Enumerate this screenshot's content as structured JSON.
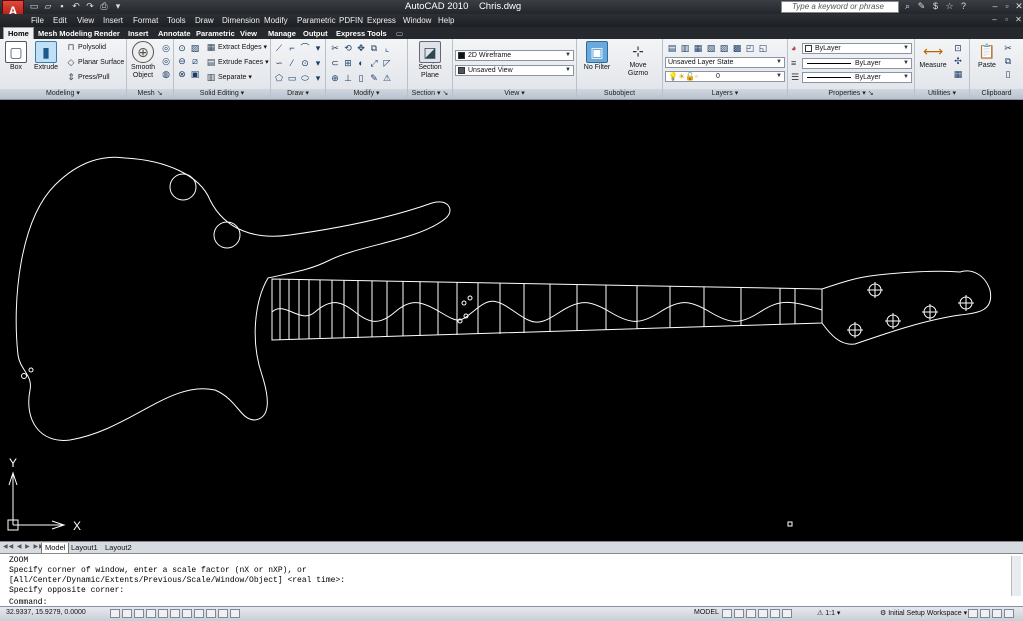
{
  "app": {
    "title": "AutoCAD 2010",
    "filename": "Chris.dwg",
    "logo_letter": "A",
    "help_placeholder": "Type a keyword or phrase"
  },
  "menus": [
    "File",
    "Edit",
    "View",
    "Insert",
    "Format",
    "Tools",
    "Draw",
    "Dimension",
    "Modify",
    "Parametric",
    "PDFIN",
    "Express",
    "Window",
    "Help"
  ],
  "ribbon_tabs": [
    "Home",
    "Mesh Modeling",
    "Render",
    "Insert",
    "Annotate",
    "Parametric",
    "View",
    "Manage",
    "Output",
    "Express Tools"
  ],
  "ribbon": {
    "modeling": {
      "title": "Modeling",
      "box": "Box",
      "extrude": "Extrude",
      "polysolid": "Polysolid",
      "planar_surface": "Planar Surface",
      "presspull": "Press/Pull"
    },
    "mesh": {
      "title": "Mesh",
      "smooth_object": "Smooth Object"
    },
    "solid_editing": {
      "title": "Solid Editing",
      "extract_edges": "Extract Edges",
      "extrude_faces": "Extrude Faces",
      "separate": "Separate"
    },
    "draw": {
      "title": "Draw"
    },
    "modify": {
      "title": "Modify"
    },
    "section": {
      "title": "Section",
      "section_plane": "Section Plane"
    },
    "view": {
      "title": "View",
      "visual_style": "2D Wireframe",
      "named_view": "Unsaved View"
    },
    "subobject": {
      "title": "Subobject",
      "no_filter": "No Filter",
      "move_gizmo": "Move Gizmo"
    },
    "layers": {
      "title": "Layers",
      "layer_state": "Unsaved Layer State",
      "current_layer": "0"
    },
    "properties": {
      "title": "Properties",
      "color": "ByLayer",
      "linetype": "ByLayer",
      "lineweight": "ByLayer"
    },
    "utilities": {
      "title": "Utilities",
      "measure": "Measure"
    },
    "clipboard": {
      "title": "Clipboard",
      "paste": "Paste"
    }
  },
  "viewport": {
    "background": "#000000",
    "line_color": "#ffffff",
    "ucs_x": "X",
    "ucs_y": "Y"
  },
  "layout_tabs": [
    "Model",
    "Layout1",
    "Layout2"
  ],
  "command_history": [
    "ZOOM",
    "Specify corner of window, enter a scale factor (nX or nXP), or",
    "[All/Center/Dynamic/Extents/Previous/Scale/Window/Object] <real time>:",
    "Specify opposite corner:"
  ],
  "command_prompt": "Command:",
  "status": {
    "coordinates": "32.9337, 15.9279, 0.0000",
    "model": "MODEL",
    "annotation_scale": "1:1",
    "workspace": "Initial Setup Workspace"
  }
}
